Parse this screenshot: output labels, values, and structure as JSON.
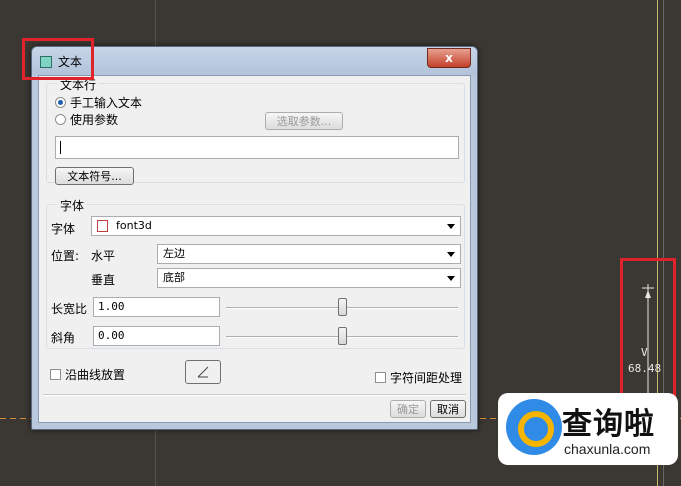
{
  "dialog": {
    "title": "文本",
    "close_label": "x",
    "text_line_group": {
      "label": "文本行",
      "radio_manual": "手工输入文本",
      "radio_param": "使用参数",
      "select_param_button": "选取参数...",
      "text_input_value": "",
      "text_symbol_button": "文本符号..."
    },
    "font_group": {
      "label": "字体",
      "font_label": "字体",
      "font_value": "font3d",
      "position_label": "位置:",
      "horizontal_label": "水平",
      "horizontal_value": "左边",
      "vertical_label": "垂直",
      "vertical_value": "底部",
      "aspect_label": "长宽比",
      "aspect_value": "1.00",
      "aspect_slider_fraction": 0.5,
      "slant_label": "斜角",
      "slant_value": "0.00",
      "slant_slider_fraction": 0.5
    },
    "place_on_curve_label": "沿曲线放置",
    "char_spacing_label": "字符间距处理",
    "ok_button": "确定",
    "cancel_button": "取消"
  },
  "canvas": {
    "dim_symbol": "V",
    "dim_value": "68.48"
  },
  "watermark": {
    "cn": "查询啦",
    "en": "chaxunla.com"
  },
  "colors": {
    "highlight": "#e0232a",
    "canvas_bg": "#3b3733"
  }
}
